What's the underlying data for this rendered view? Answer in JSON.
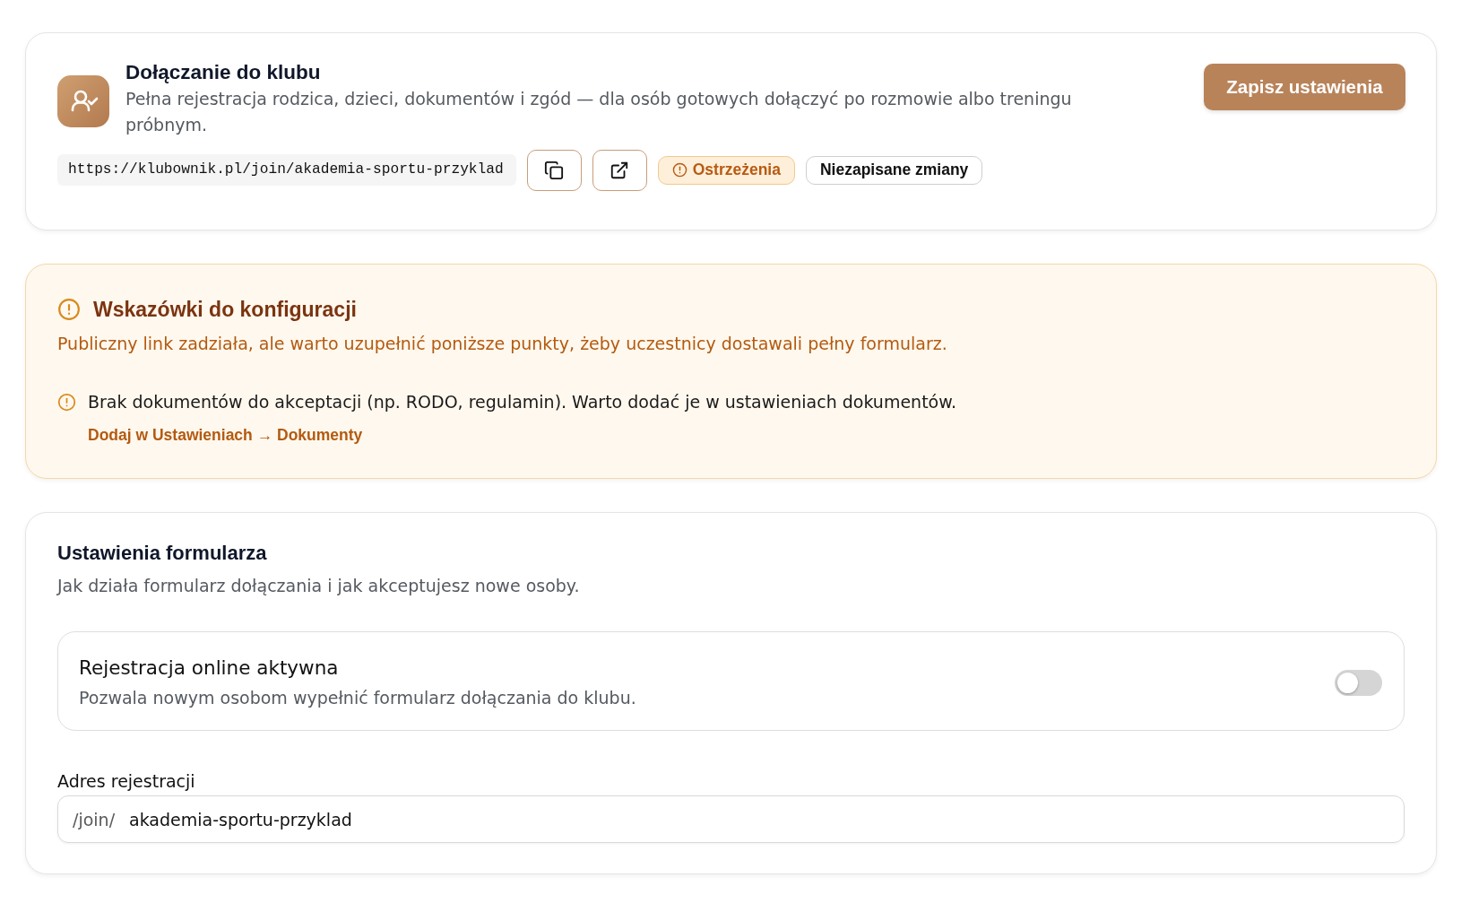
{
  "header": {
    "title": "Dołączanie do klubu",
    "description": "Pełna rejestracja rodzica, dzieci, dokumentów i zgód — dla osób gotowych dołączyć po rozmowie albo treningu próbnym.",
    "save_button": "Zapisz ustawienia",
    "public_url": "https://klubownik.pl/join/akademia-sportu-przyklad",
    "badges": [
      {
        "kind": "warning",
        "label": "Ostrzeżenia"
      },
      {
        "kind": "neutral",
        "label": "Niezapisane zmiany"
      }
    ]
  },
  "warnings_panel": {
    "title": "Wskazówki do konfiguracji",
    "description": "Publiczny link zadziała, ale warto uzupełnić poniższe punkty, żeby uczestnicy dostawali pełny formularz.",
    "items": [
      {
        "text": "Brak dokumentów do akceptacji (np. RODO, regulamin). Warto dodać je w ustawieniach dokumentów.",
        "link": "Dodaj w Ustawieniach → Dokumenty"
      }
    ]
  },
  "form_settings": {
    "title": "Ustawienia formularza",
    "description": "Jak działa formularz dołączania i jak akceptujesz nowe osoby.",
    "toggles": [
      {
        "label": "Rejestracja online aktywna",
        "description": "Pozwala nowym osobom wypełnić formularz dołączania do klubu.",
        "on": false
      }
    ],
    "address_field": {
      "label": "Adres rejestracji",
      "prefix": "/join/",
      "value": "akademia-sportu-przyklad"
    }
  }
}
